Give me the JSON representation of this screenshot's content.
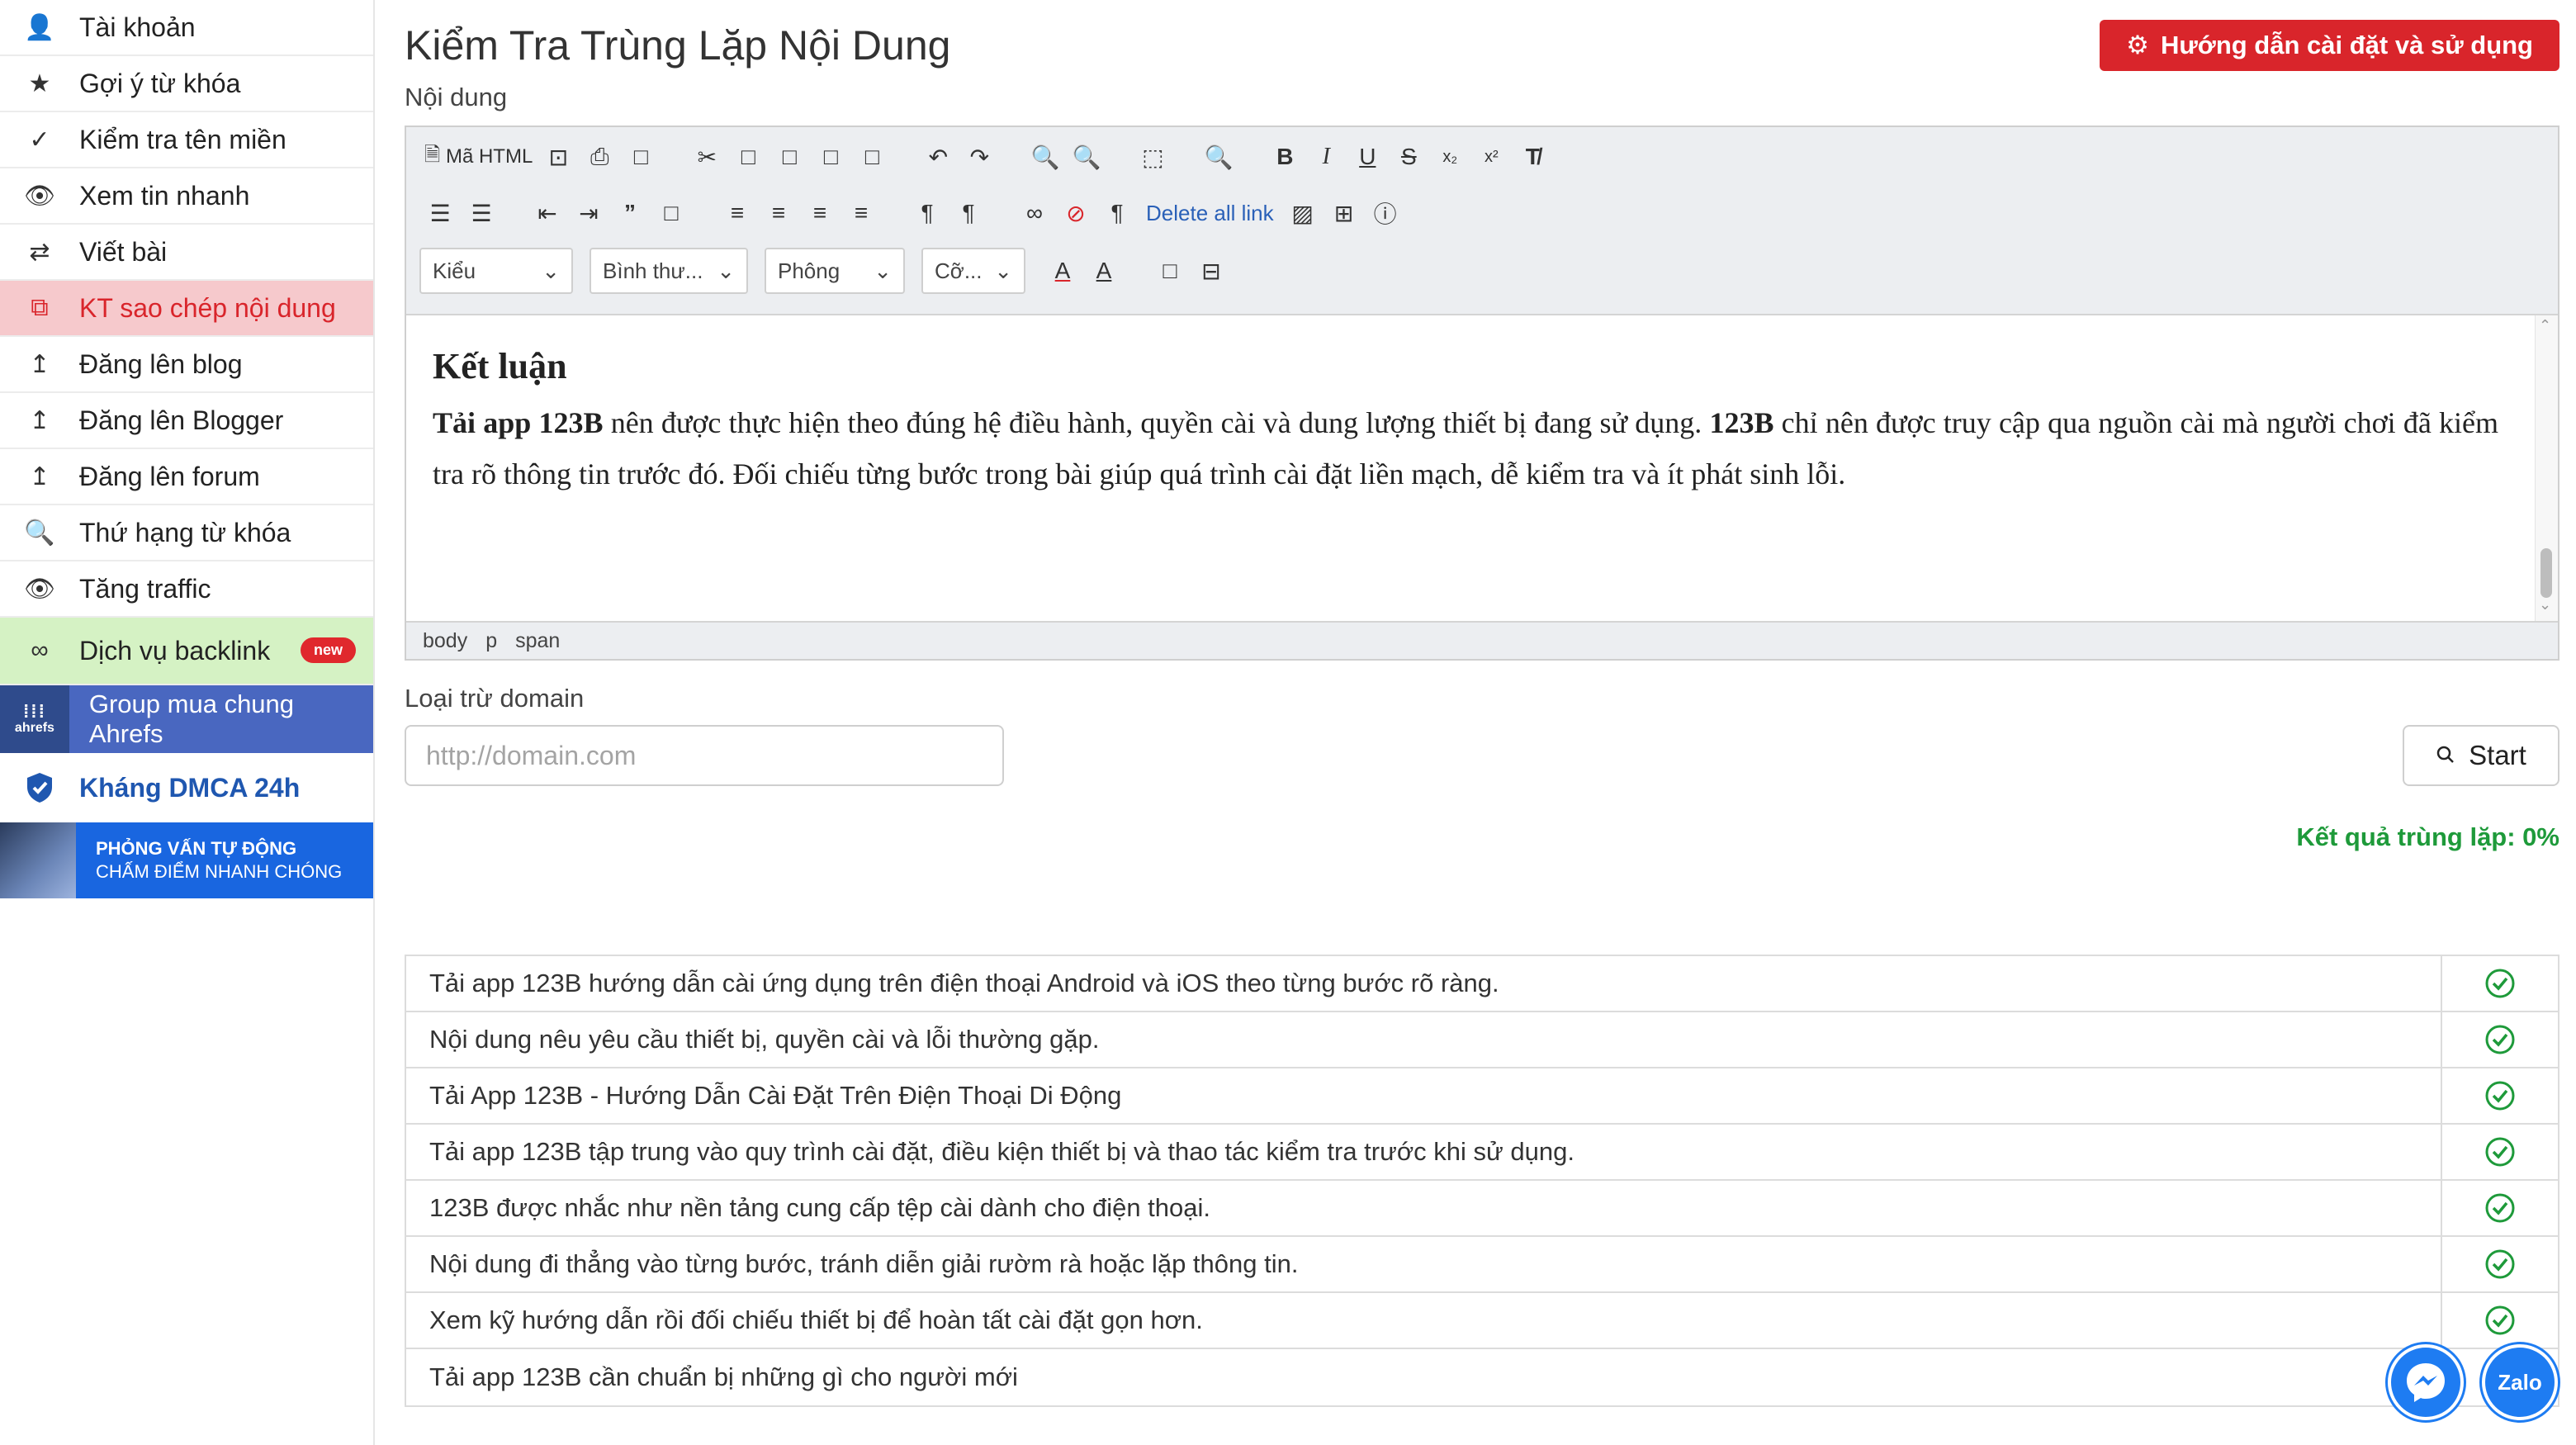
{
  "sidebar": {
    "items": [
      {
        "label": "Tài khoản",
        "icon": "user-icon",
        "glyph": "👤"
      },
      {
        "label": "Gợi ý từ khóa",
        "icon": "star-icon",
        "glyph": "★"
      },
      {
        "label": "Kiểm tra tên miền",
        "icon": "check-icon",
        "glyph": "✓"
      },
      {
        "label": "Xem tin nhanh",
        "icon": "eye-icon",
        "glyph": "👁"
      },
      {
        "label": "Viết bài",
        "icon": "exchange-icon",
        "glyph": "⇄"
      },
      {
        "label": "KT sao chép nội dung",
        "icon": "copy-icon",
        "glyph": "⧉"
      },
      {
        "label": "Đăng lên blog",
        "icon": "upload-icon",
        "glyph": "↥"
      },
      {
        "label": "Đăng lên Blogger",
        "icon": "upload-icon",
        "glyph": "↥"
      },
      {
        "label": "Đăng lên forum",
        "icon": "upload-icon",
        "glyph": "↥"
      },
      {
        "label": "Thứ hạng từ khóa",
        "icon": "search-icon",
        "glyph": "🔍"
      },
      {
        "label": "Tăng traffic",
        "icon": "eye-icon",
        "glyph": "👁"
      },
      {
        "label": "Dịch vụ backlink",
        "icon": "link-icon",
        "glyph": "∞",
        "badge": "new"
      }
    ],
    "ahrefs": {
      "logo_text": "ahrefs",
      "label": "Group mua chung Ahrefs"
    },
    "dmca": {
      "label": "Kháng DMCA 24h"
    },
    "banner": {
      "line1": "PHỎNG VẤN TỰ ĐỘNG",
      "line2": "CHẤM ĐIỂM NHANH CHÓNG"
    }
  },
  "header": {
    "title": "Kiểm Tra Trùng Lặp Nội Dung",
    "guide_button": "Hướng dẫn cài đặt và sử dụng"
  },
  "editor": {
    "label": "Nội dung",
    "html_button": "Mã HTML",
    "delete_links": "Delete all link",
    "selects": {
      "style": "Kiểu",
      "format": "Bình thư...",
      "font": "Phông",
      "size": "Cỡ..."
    },
    "heading": "Kết luận",
    "paragraph": {
      "b1": "Tải app 123B",
      "t1": " nên được thực hiện theo đúng hệ điều hành, quyền cài và dung lượng thiết bị đang sử dụng. ",
      "b2": "123B",
      "t2": " chỉ nên được truy cập qua nguồn cài mà người chơi đã kiểm tra rõ thông tin trước đó. Đối chiếu từng bước trong bài giúp quá trình cài đặt liền mạch, dễ kiểm tra và ít phát sinh lỗi."
    },
    "path": [
      "body",
      "p",
      "span"
    ]
  },
  "domain": {
    "label": "Loại trừ domain",
    "placeholder": "http://domain.com",
    "value": ""
  },
  "start_button": "Start",
  "result_text": "Kết quả trùng lặp: 0%",
  "results": [
    {
      "text": "Tải app 123B hướng dẫn cài ứng dụng trên điện thoại Android và iOS theo từng bước rõ ràng.",
      "ok": true
    },
    {
      "text": "Nội dung nêu yêu cầu thiết bị, quyền cài và lỗi thường gặp.",
      "ok": true
    },
    {
      "text": "Tải App 123B - Hướng Dẫn Cài Đặt Trên Điện Thoại Di Động",
      "ok": true
    },
    {
      "text": "Tải app 123B tập trung vào quy trình cài đặt, điều kiện thiết bị và thao tác kiểm tra trước khi sử dụng.",
      "ok": true
    },
    {
      "text": "123B được nhắc như nền tảng cung cấp tệp cài dành cho điện thoại.",
      "ok": true
    },
    {
      "text": "Nội dung đi thẳng vào từng bước, tránh diễn giải rườm rà hoặc lặp thông tin.",
      "ok": true
    },
    {
      "text": "Xem kỹ hướng dẫn rồi đối chiếu thiết bị để hoàn tất cài đặt gọn hơn.",
      "ok": true
    },
    {
      "text": "Tải app 123B cần chuẩn bị những gì cho người mới",
      "ok": false
    }
  ],
  "floating": {
    "zalo_label": "Zalo"
  },
  "colors": {
    "accent_red": "#d9252b",
    "ok_green": "#1e9a3a",
    "link_blue": "#2a60b8",
    "sidebar_active": "#f6c9cc",
    "sidebar_green": "#d5f2c4"
  }
}
